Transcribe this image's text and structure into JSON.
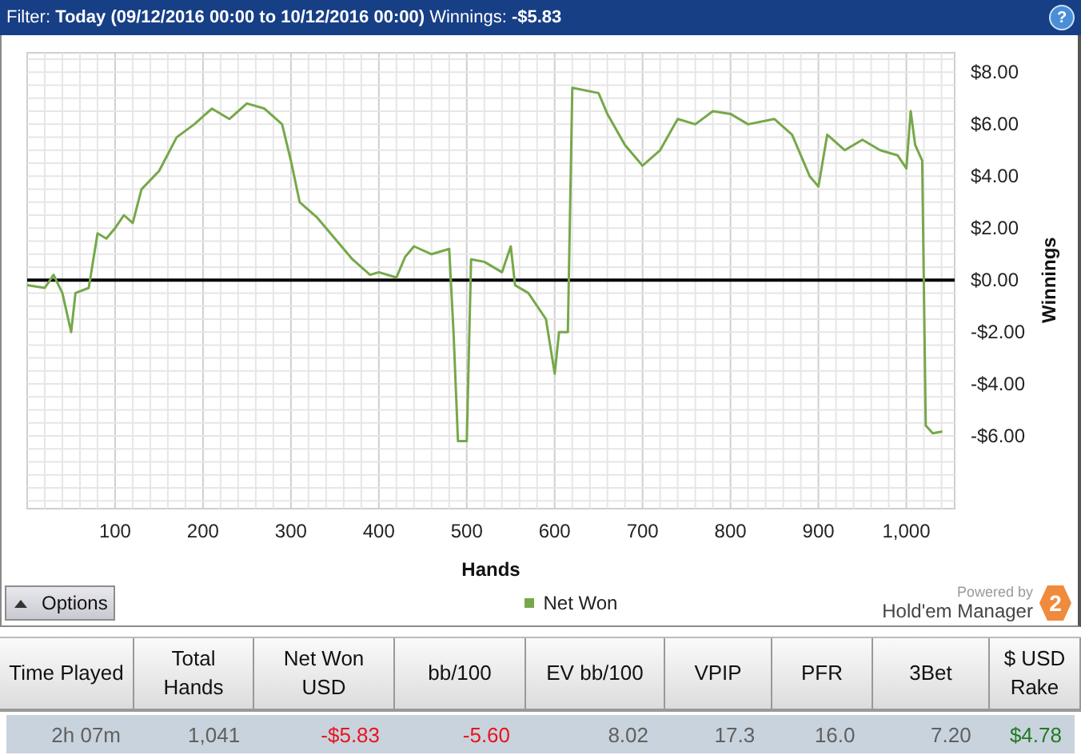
{
  "filter_bar": {
    "text": "Filter: **Today (09/12/2016 00:00 to 10/12/2016 00:00)** Winnings: **-$5.83**",
    "help": "?"
  },
  "chart": {
    "chart_data": {
      "type": "line",
      "grid": true,
      "xlabel": "Hands",
      "ylabel": "Winnings",
      "xlim": [
        0,
        1055
      ],
      "ylim": [
        -8.8,
        8.75
      ],
      "xticks": [
        100,
        200,
        300,
        400,
        500,
        600,
        700,
        800,
        900,
        {
          "value": 1000,
          "label": "1,000"
        }
      ],
      "yticks": [
        {
          "value": 8,
          "label": "$8.00"
        },
        {
          "value": 6,
          "label": "$6.00"
        },
        {
          "value": 4,
          "label": "$4.00"
        },
        {
          "value": 2,
          "label": "$2.00"
        },
        {
          "value": 0,
          "label": "$0.00"
        },
        {
          "value": -2,
          "label": "-$2.00"
        },
        {
          "value": -4,
          "label": "-$4.00"
        },
        {
          "value": -6,
          "label": "-$6.00"
        }
      ],
      "x": [
        0,
        20,
        30,
        40,
        50,
        55,
        70,
        80,
        90,
        100,
        110,
        120,
        130,
        150,
        170,
        190,
        210,
        230,
        250,
        270,
        290,
        300,
        310,
        330,
        350,
        370,
        390,
        400,
        420,
        430,
        440,
        460,
        480,
        485,
        490,
        500,
        505,
        520,
        540,
        550,
        555,
        570,
        590,
        600,
        605,
        615,
        620,
        650,
        660,
        680,
        700,
        720,
        740,
        760,
        780,
        800,
        820,
        850,
        870,
        890,
        900,
        910,
        930,
        950,
        970,
        990,
        1000,
        1005,
        1010,
        1018,
        1022,
        1030,
        1041
      ],
      "series": [
        {
          "name": "Net Won",
          "color": "#76a84a",
          "values": [
            -0.2,
            -0.3,
            0.2,
            -0.5,
            -2.0,
            -0.5,
            -0.3,
            1.8,
            1.6,
            2.0,
            2.5,
            2.2,
            3.5,
            4.2,
            5.5,
            6.0,
            6.6,
            6.2,
            6.8,
            6.6,
            6.0,
            4.6,
            3.0,
            2.4,
            1.6,
            0.8,
            0.2,
            0.3,
            0.1,
            0.9,
            1.3,
            1.0,
            1.2,
            -2.0,
            -6.2,
            -6.2,
            0.8,
            0.7,
            0.3,
            1.3,
            -0.2,
            -0.5,
            -1.5,
            -3.6,
            -2.0,
            -2.0,
            7.4,
            7.2,
            6.4,
            5.2,
            4.4,
            5.0,
            6.2,
            6.0,
            6.5,
            6.4,
            6.0,
            6.2,
            5.6,
            4.0,
            3.6,
            5.6,
            5.0,
            5.4,
            5.0,
            4.8,
            4.3,
            6.5,
            5.2,
            4.6,
            -5.6,
            -5.9,
            -5.83
          ]
        }
      ]
    },
    "options_button": "Options",
    "powered_by": "Powered by",
    "brand": "Hold'em Manager",
    "brand_badge": "2"
  },
  "stats_table": {
    "columns": [
      "Time Played",
      "Total Hands",
      "Net Won USD",
      "bb/100",
      "EV bb/100",
      "VPIP",
      "PFR",
      "3Bet",
      "$ USD Rake"
    ],
    "row": [
      {
        "text": "2h 07m",
        "color": "#606060"
      },
      {
        "text": "1,041",
        "color": "#606060"
      },
      {
        "text": "-$5.83",
        "color": "#e8141c"
      },
      {
        "text": "-5.60",
        "color": "#e8141c"
      },
      {
        "text": "8.02",
        "color": "#606060"
      },
      {
        "text": "17.3",
        "color": "#606060"
      },
      {
        "text": "16.0",
        "color": "#606060"
      },
      {
        "text": "7.20",
        "color": "#606060"
      },
      {
        "text": "$4.78",
        "color": "#217a21"
      }
    ]
  }
}
